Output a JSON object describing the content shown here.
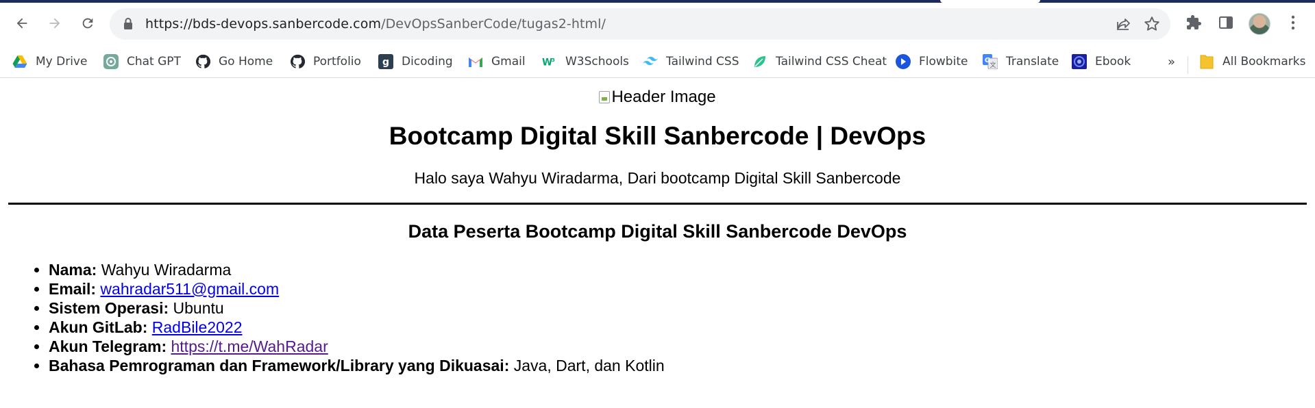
{
  "browser": {
    "url_host": "https://bds-devops.sanbercode.com",
    "url_path": "/DevOpsSanberCode/tugas2-html/",
    "bookmarks": [
      {
        "label": "My Drive",
        "icon": "google-drive-icon"
      },
      {
        "label": "Chat GPT",
        "icon": "chatgpt-icon"
      },
      {
        "label": "Go Home",
        "icon": "github-icon"
      },
      {
        "label": "Portfolio",
        "icon": "github-icon"
      },
      {
        "label": "Dicoding",
        "icon": "dicoding-icon"
      },
      {
        "label": "Gmail",
        "icon": "gmail-icon"
      },
      {
        "label": "W3Schools",
        "icon": "w3schools-icon"
      },
      {
        "label": "Tailwind CSS",
        "icon": "tailwind-icon"
      },
      {
        "label": "Tailwind CSS Cheat",
        "icon": "leaf-icon"
      },
      {
        "label": "Flowbite",
        "icon": "flowbite-icon"
      },
      {
        "label": "Translate",
        "icon": "google-translate-icon"
      },
      {
        "label": "Ebook",
        "icon": "ebook-icon"
      }
    ],
    "more_label": "»",
    "all_bookmarks_label": "All Bookmarks"
  },
  "page": {
    "header_image_alt": "Header Image",
    "title": "Bootcamp Digital Skill Sanbercode | DevOps",
    "subtitle": "Halo saya Wahyu Wiradarma, Dari bootcamp Digital Skill Sanbercode",
    "section_title": "Data Peserta Bootcamp Digital Skill Sanbercode DevOps",
    "items": {
      "nama": {
        "label": "Nama:",
        "value": "Wahyu Wiradarma"
      },
      "email": {
        "label": "Email:",
        "value": "wahradar511@gmail.com"
      },
      "os": {
        "label": "Sistem Operasi:",
        "value": "Ubuntu"
      },
      "gitlab": {
        "label": "Akun GitLab:",
        "value": "RadBile2022"
      },
      "telegram": {
        "label": "Akun Telegram:",
        "value": "https://t.me/WahRadar"
      },
      "bahasa": {
        "label": "Bahasa Pemrograman dan Framework/Library yang Dikuasai:",
        "value": "Java, Dart, dan Kotlin"
      }
    }
  },
  "colors": {
    "link": "#0000ee",
    "visited_link": "#551a8b",
    "omnibox_bg": "#f1f3f4",
    "tabstrip": "#1c2b5a"
  }
}
